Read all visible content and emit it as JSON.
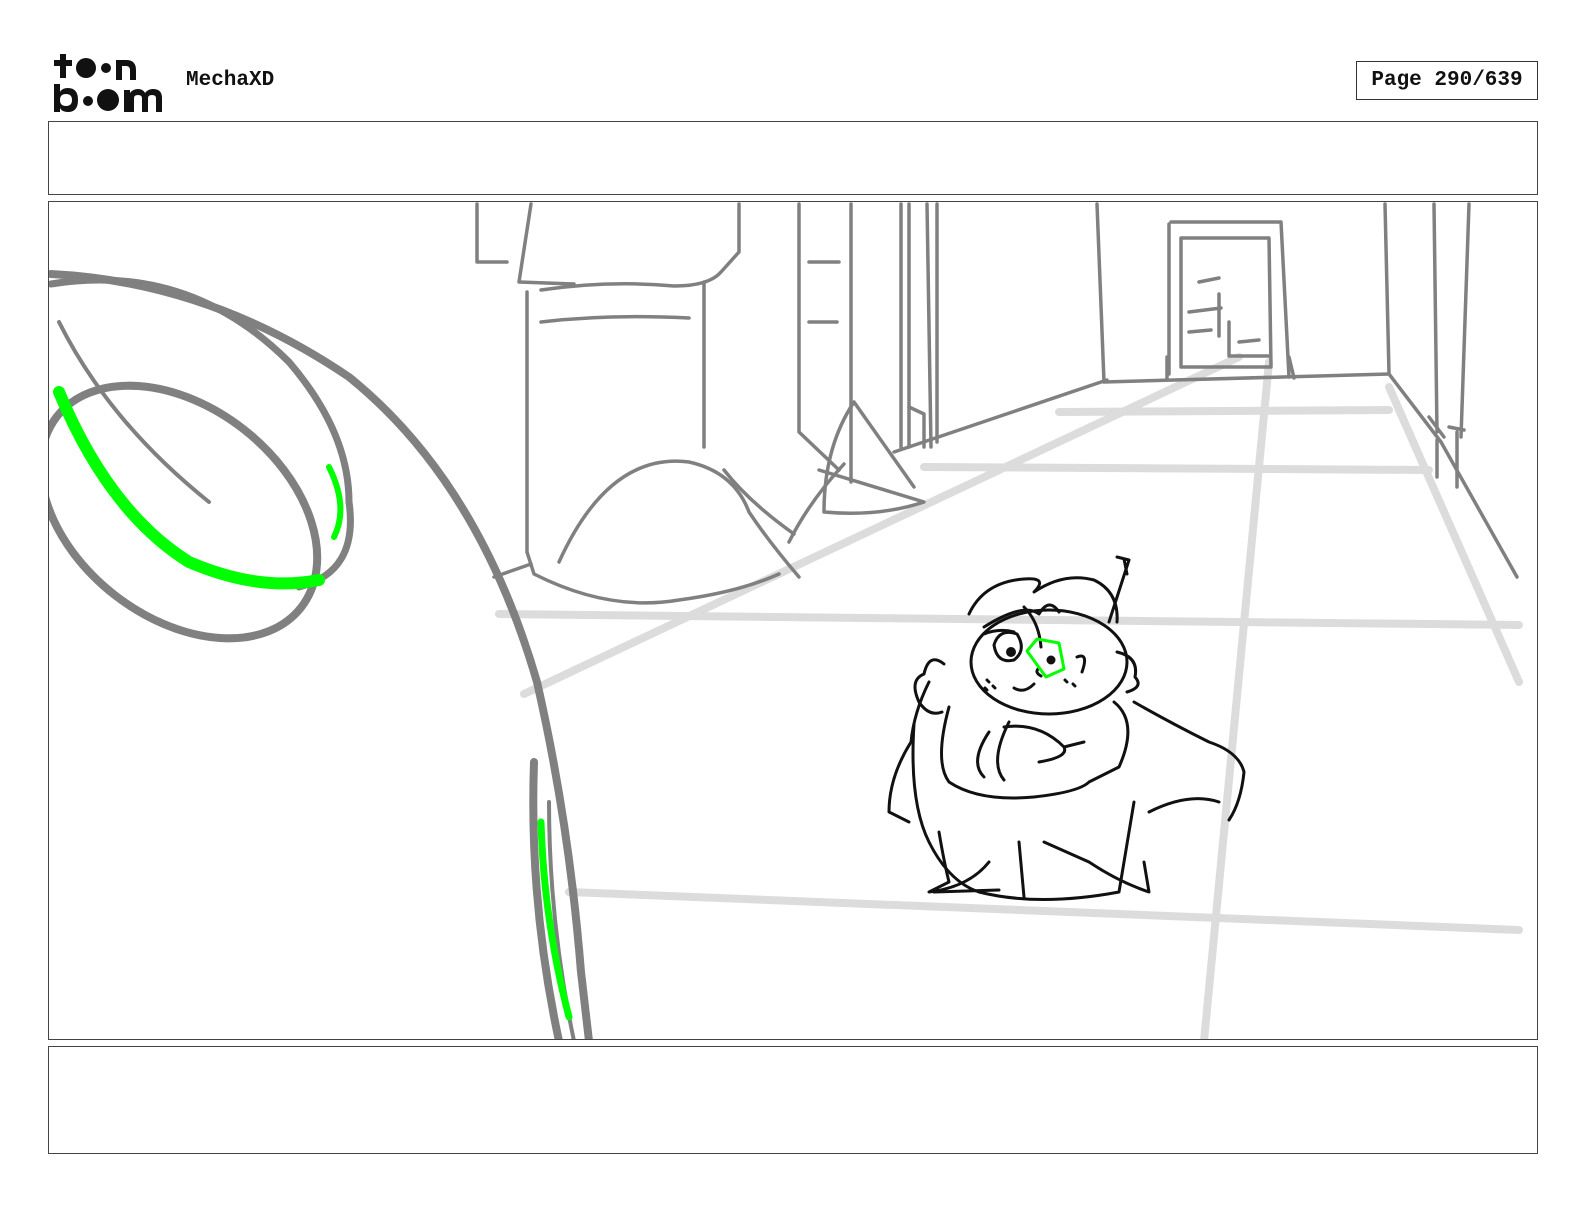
{
  "header": {
    "logo_text": "toon boom",
    "project_title": "MechaXD",
    "page_label": "Page 290/639"
  },
  "caption_top": {
    "text": ""
  },
  "caption_bottom": {
    "text": ""
  },
  "colors": {
    "sketch_gray": "#808080",
    "floor_gray": "#dcdcdc",
    "ink": "#111111",
    "highlight_green": "#00ff00"
  }
}
